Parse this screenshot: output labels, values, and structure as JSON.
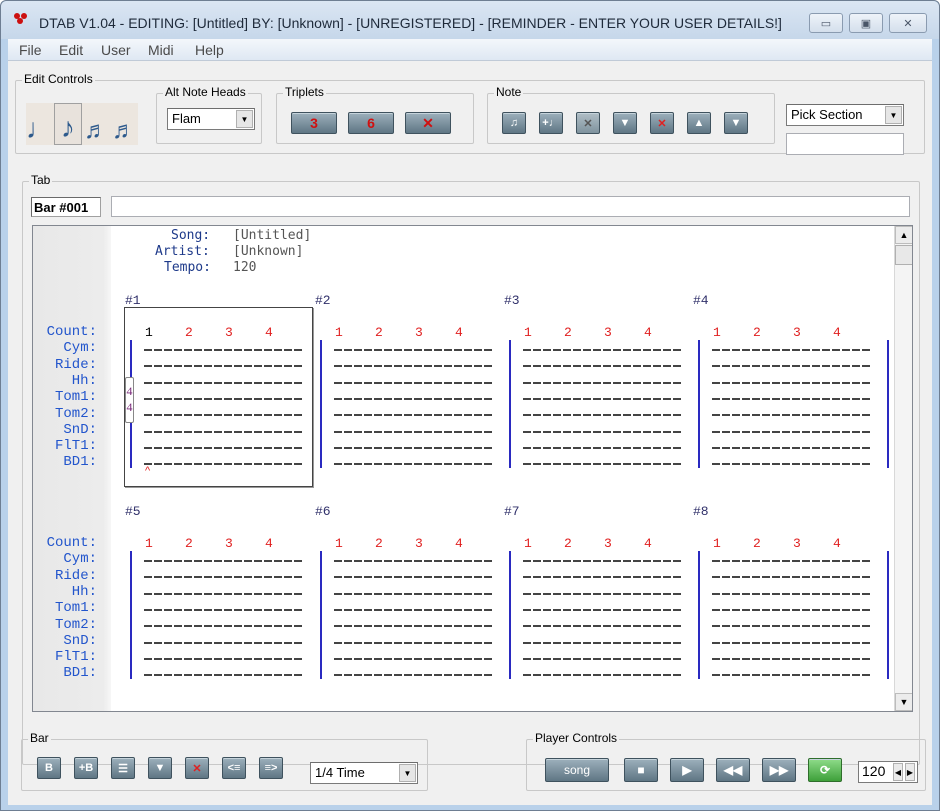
{
  "window": {
    "title": "DTAB V1.04 - EDITING: [Untitled]   BY: [Unknown] - [UNREGISTERED] - [REMINDER - ENTER YOUR USER DETAILS!]",
    "minimize_icon": "minimize-icon",
    "maximize_icon": "maximize-icon",
    "close_icon": "close-icon"
  },
  "menu": [
    "File",
    "Edit",
    "User",
    "Midi",
    "Help"
  ],
  "edit_controls": {
    "label": "Edit Controls",
    "note_durations": [
      {
        "name": "quarter-note",
        "glyph": "♩"
      },
      {
        "name": "eighth-note",
        "glyph": "♪",
        "selected": true
      },
      {
        "name": "sixteenth-note",
        "glyph": "𝅘𝅥𝅯"
      },
      {
        "name": "thirty-second-note",
        "glyph": "𝅘𝅥𝅰"
      }
    ],
    "alt_note_heads": {
      "label": "Alt Note Heads",
      "value": "Flam"
    },
    "triplets": {
      "label": "Triplets",
      "buttons": [
        "3",
        "6",
        "✕"
      ]
    },
    "note": {
      "label": "Note",
      "buttons": [
        "note-split",
        "note-insert",
        "note-clear",
        "note-flip",
        "note-delete",
        "note-up",
        "note-down"
      ]
    },
    "pick_section": {
      "value": "Pick Section",
      "text": ""
    }
  },
  "tab": {
    "label": "Tab",
    "bar_label": "Bar #001",
    "bar_text": "",
    "header": {
      "song_label": "Song:",
      "song": "[Untitled]",
      "artist_label": "Artist:",
      "artist": "[Unknown]",
      "tempo_label": "Tempo:",
      "tempo": "120"
    },
    "drum_labels": [
      "Count:",
      "Cym:",
      "Ride:",
      "Hh:",
      "Tom1:",
      "Tom2:",
      "SnD:",
      "FlT1:",
      "BD1:"
    ],
    "counts": [
      "1",
      "2",
      "3",
      "4"
    ],
    "bars": [
      "#1",
      "#2",
      "#3",
      "#4",
      "#5",
      "#6",
      "#7",
      "#8"
    ],
    "time_signature": [
      "4",
      "4"
    ],
    "cursor": "^"
  },
  "bar_group": {
    "label": "Bar",
    "buttons": [
      "bar-copy",
      "bar-insert",
      "bar-clear",
      "bar-flip",
      "bar-delete",
      "bar-shift-left",
      "bar-shift-right"
    ],
    "time_value": "1/4 Time"
  },
  "player": {
    "label": "Player Controls",
    "song_button": "song",
    "tempo": "120"
  }
}
